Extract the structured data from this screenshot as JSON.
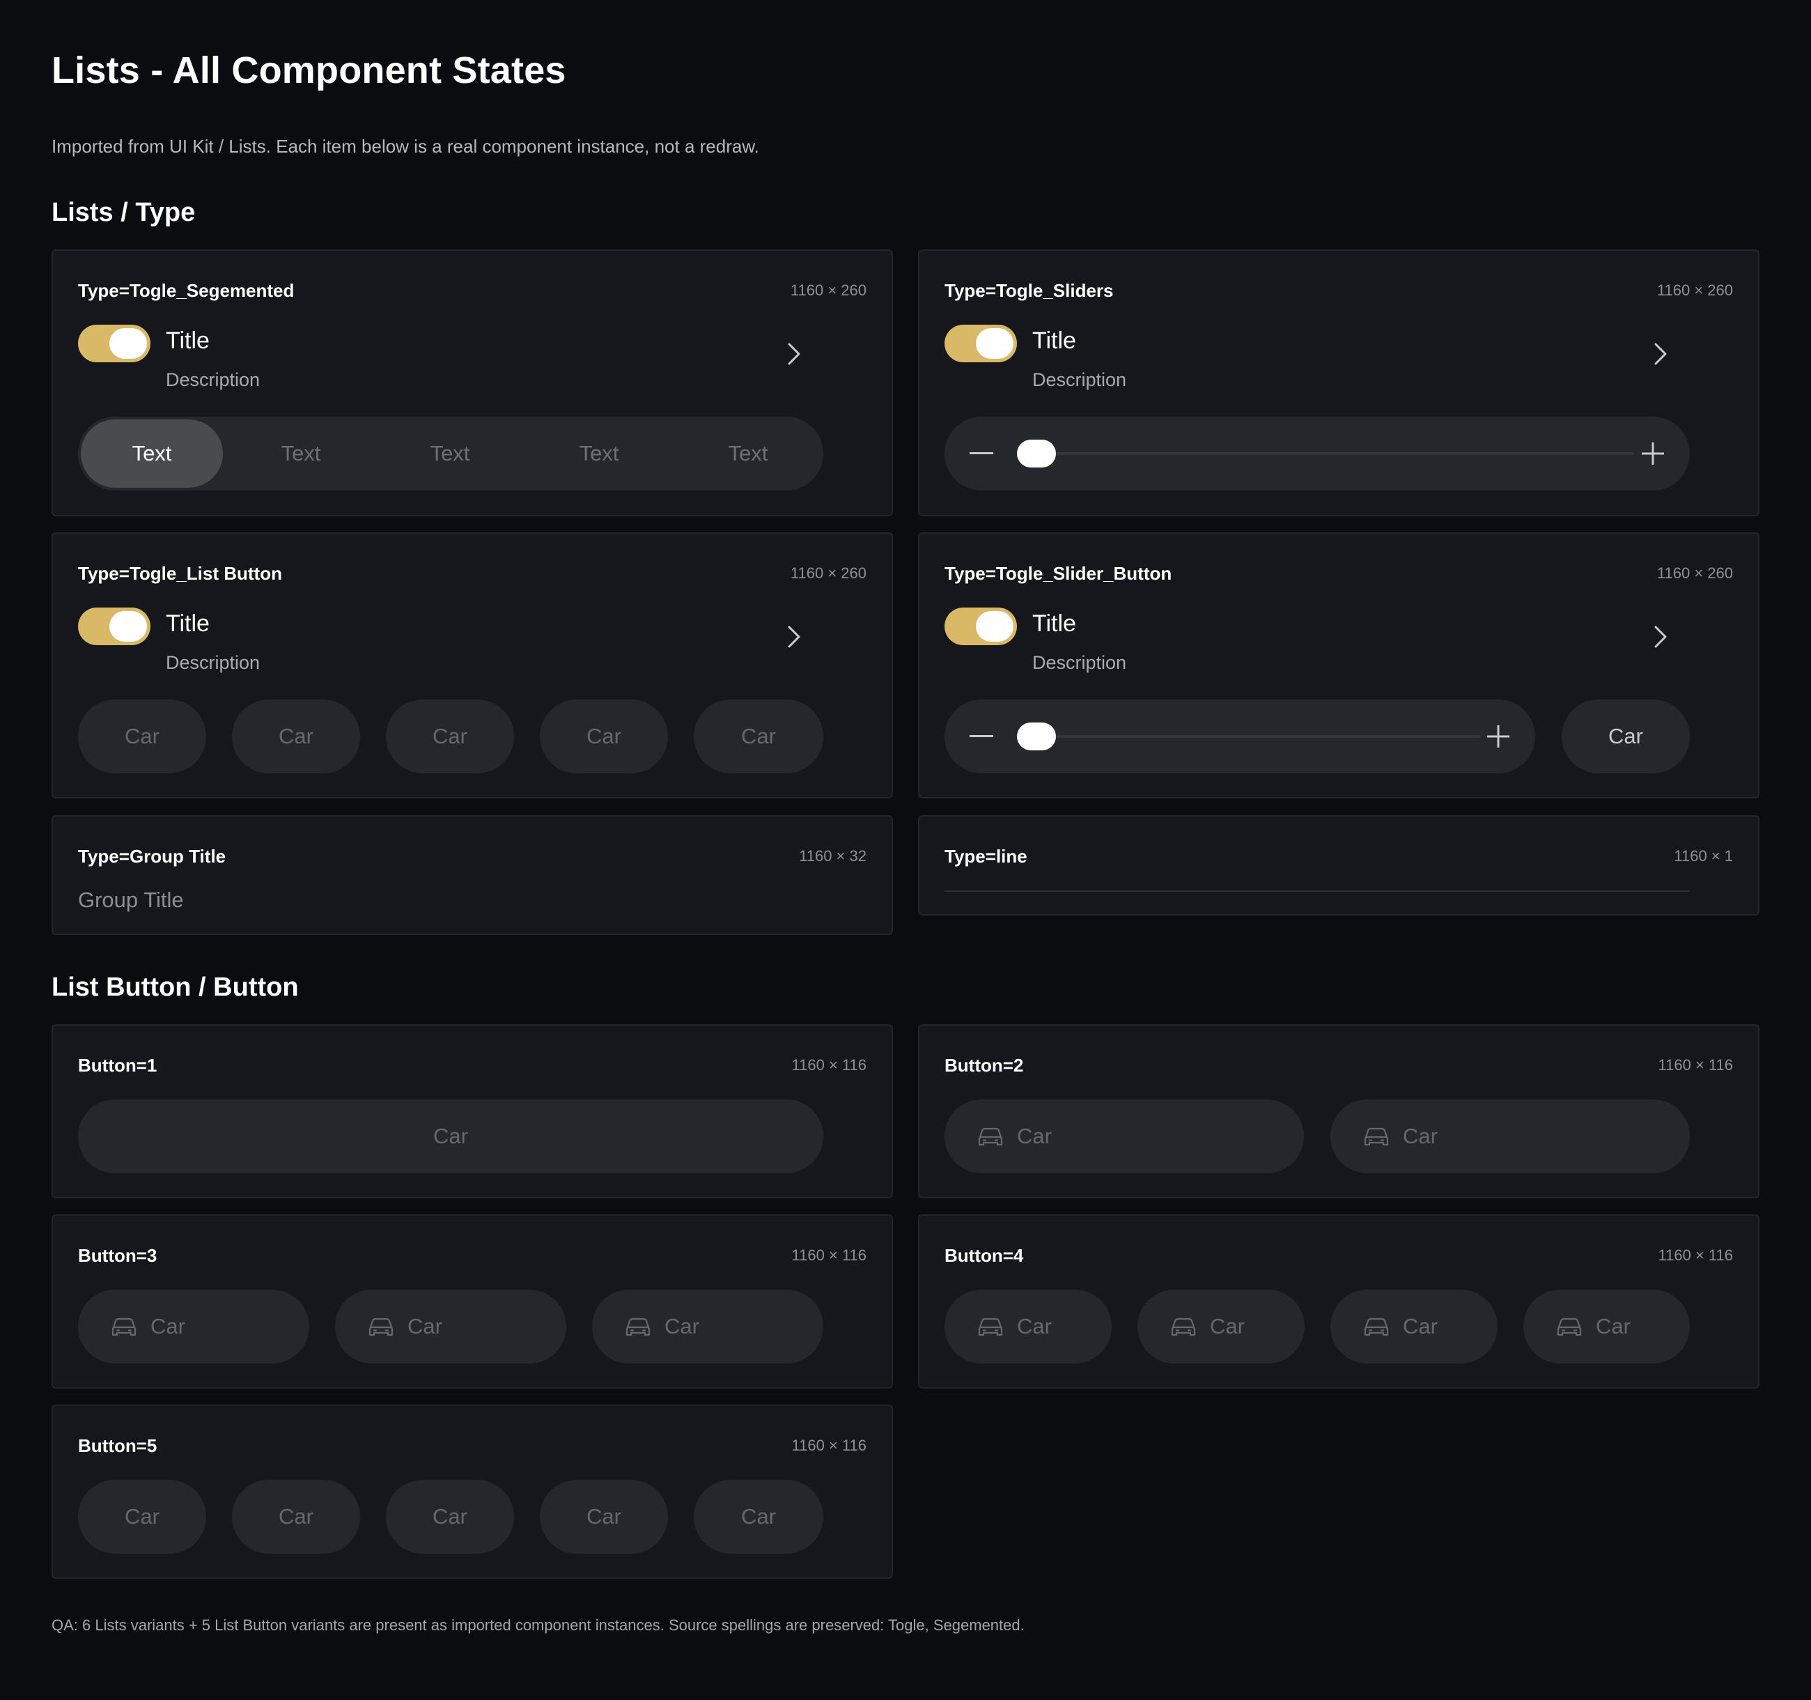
{
  "page": {
    "title": "Lists - All Component States",
    "subtitle": "Imported from UI Kit / Lists. Each item below is a real component instance, not a redraw."
  },
  "sections": {
    "lists_type": "Lists / Type",
    "list_button": "List Button / Button"
  },
  "row": {
    "title": "Title",
    "description": "Description"
  },
  "accent_color": "#d9b866",
  "cards": {
    "segmented": {
      "label": "Type=Togle_Segemented",
      "dims": "1160 × 260",
      "segments": [
        "Text",
        "Text",
        "Text",
        "Text",
        "Text"
      ],
      "active_index": 0
    },
    "sliders": {
      "label": "Type=Togle_Sliders",
      "dims": "1160 × 260",
      "slider_value": 0
    },
    "list_button": {
      "label": "Type=Togle_List Button",
      "dims": "1160 × 260",
      "buttons": [
        "Car",
        "Car",
        "Car",
        "Car",
        "Car"
      ]
    },
    "slider_button": {
      "label": "Type=Togle_Slider_Button",
      "dims": "1160 × 260",
      "button": "Car",
      "slider_value": 0
    },
    "group_title": {
      "label": "Type=Group Title",
      "dims": "1160 × 32",
      "text": "Group Title"
    },
    "line": {
      "label": "Type=line",
      "dims": "1160 × 1"
    },
    "button1": {
      "label": "Button=1",
      "dims": "1160 × 116",
      "buttons": [
        "Car"
      ]
    },
    "button2": {
      "label": "Button=2",
      "dims": "1160 × 116",
      "buttons": [
        "Car",
        "Car"
      ],
      "icon": "car-icon"
    },
    "button3": {
      "label": "Button=3",
      "dims": "1160 × 116",
      "buttons": [
        "Car",
        "Car",
        "Car"
      ],
      "icon": "car-icon"
    },
    "button4": {
      "label": "Button=4",
      "dims": "1160 × 116",
      "buttons": [
        "Car",
        "Car",
        "Car",
        "Car"
      ],
      "icon": "car-icon"
    },
    "button5": {
      "label": "Button=5",
      "dims": "1160 × 116",
      "buttons": [
        "Car",
        "Car",
        "Car",
        "Car",
        "Car"
      ]
    }
  },
  "qa_note": "QA: 6 Lists variants + 5 List Button variants are present as imported component instances. Source spellings are preserved: Togle, Segemented."
}
